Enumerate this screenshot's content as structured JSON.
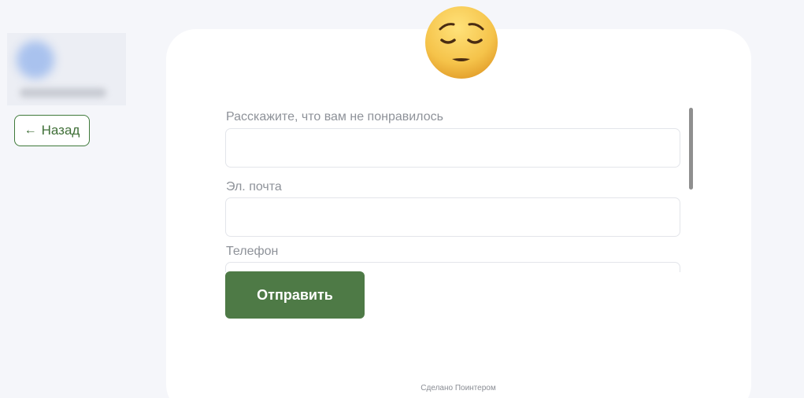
{
  "back_button": {
    "label": "Назад",
    "icon": "arrow-left-icon"
  },
  "header": {
    "emoji": "pensive-face-icon"
  },
  "form": {
    "fields": [
      {
        "label": "Расскажите, что вам не понравилось",
        "value": ""
      },
      {
        "label": "Эл. почта",
        "value": ""
      },
      {
        "label": "Телефон",
        "value": ""
      }
    ],
    "submit_label": "Отправить"
  },
  "footer": {
    "text": "Сделано Поинтером"
  },
  "colors": {
    "background": "#f5f6fa",
    "card": "#ffffff",
    "accent_green": "#4e7a46",
    "label_gray": "#8e9299"
  }
}
